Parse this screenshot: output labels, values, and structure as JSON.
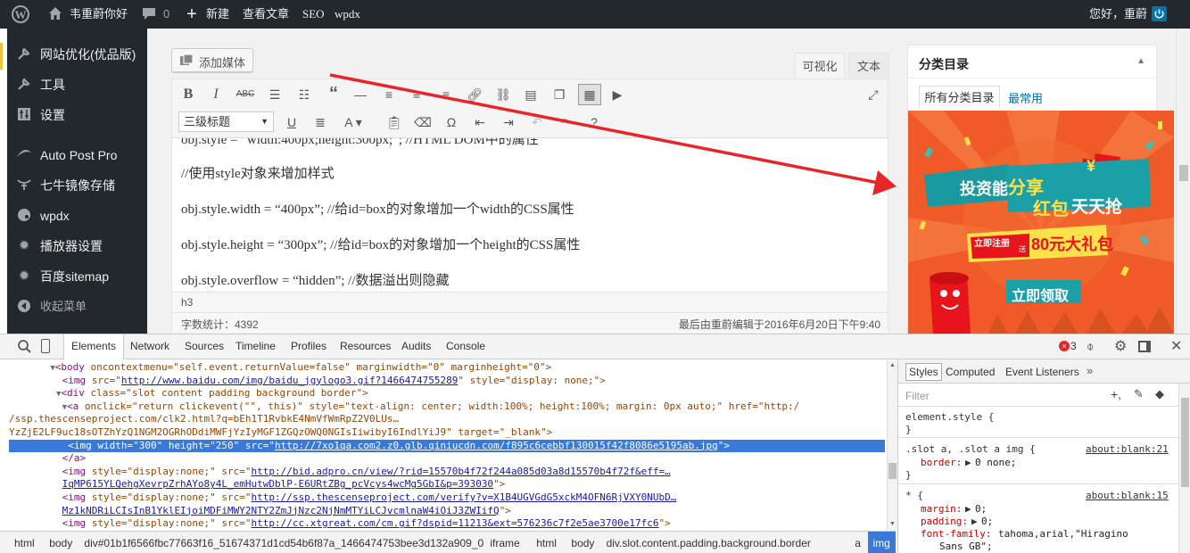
{
  "adminbar": {
    "site_name": "韦重蔚你好",
    "comments_count": "0",
    "new_label": "新建",
    "view_post": "查看文章",
    "seo": "SEO",
    "wpdx": "wpdx",
    "greeting": "您好，重蔚"
  },
  "sidebar": {
    "items": [
      {
        "label": "网站优化(优品版)",
        "icon": "wrench-icon"
      },
      {
        "label": "工具",
        "icon": "wrench-icon"
      },
      {
        "label": "设置",
        "icon": "settings-icon"
      },
      {
        "label": "Auto Post Pro",
        "icon": "app-icon"
      },
      {
        "label": "七牛镜像存储",
        "icon": "bucket-icon"
      },
      {
        "label": "wpdx",
        "icon": "palette-icon"
      },
      {
        "label": "播放器设置",
        "icon": "gear-icon"
      },
      {
        "label": "百度sitemap",
        "icon": "gear-icon"
      },
      {
        "label": "收起菜单",
        "icon": "collapse-icon"
      }
    ]
  },
  "editor": {
    "add_media": "添加媒体",
    "tab_visual": "可视化",
    "tab_text": "文本",
    "format_select": "三级标题",
    "lines": [
      "obj.style = “width:400px;height:300px;”; //HTML DOM中的属性",
      "//使用style对象来增加样式",
      "obj.style.width = “400px”;  //给id=box的对象增加一个width的CSS属性",
      "obj.style.height = “300px”; //给id=box的对象增加一个height的CSS属性",
      "obj.style.overflow = “hidden”;  //数据溢出则隐藏"
    ],
    "path": "h3",
    "word_count": "字数统计：4392",
    "last_edited": "最后由重蔚编辑于2016年6月20日下午9:40"
  },
  "category_box": {
    "title": "分类目录",
    "tab_all": "所有分类目录",
    "tab_common": "最常用"
  },
  "ad": {
    "line1a": "投资能",
    "line1b": "分享",
    "line2a": "红包",
    "line2b": "天天抢",
    "badge_small": "立即注册",
    "badge_tiny": "送",
    "badge_big": "80元大礼包",
    "button": "立即领取",
    "yen": "¥",
    "colors": {
      "bg": "#f05a28",
      "teal": "#1a9aa0",
      "yellow": "#ffe14a",
      "red": "#e8141b"
    }
  },
  "devtools": {
    "tabs": [
      "Elements",
      "Network",
      "Sources",
      "Timeline",
      "Profiles",
      "Resources",
      "Audits",
      "Console"
    ],
    "active_tab": "Elements",
    "error_count": "3",
    "lines": [
      {
        "indent": 7,
        "arrow": "▼",
        "tag": "<body",
        "attrs": " oncontextmenu=\"self.event.returnValue=false\" marginwidth=\"0\" marginheight=\"0\">",
        "tail": ""
      },
      {
        "indent": 9,
        "arrow": "",
        "tag": "<img",
        "attrs": " src=\"",
        "link": "http://www.baidu.com/img/baidu_jgylogo3.gif?1466474755289",
        "tail": "\" style=\"display: none;\">"
      },
      {
        "indent": 8,
        "arrow": "▼",
        "tag": "<div",
        "attrs": " class=\"slot content padding background border\">",
        "tail": ""
      },
      {
        "indent": 9,
        "arrow": "▼",
        "tag": "<a",
        "attrs": " onclick=\"return clickevent(\"\", this)\" style=\"text-align: center; width:100%; height:100%; margin: 0px auto;\" href=\"http:/",
        "tail": ""
      },
      {
        "indent": 0,
        "arrow": "",
        "tag": "",
        "attrs": "/ssp.thescenseproject.com/clk2.html?q=bEh1T1RvbkE4NmVfWmRpZ2V0LUs…",
        "tail": ""
      },
      {
        "indent": 0,
        "arrow": "",
        "tag": "",
        "attrs": "YzZjE2LF9uc18sOTZhYzQ1NGM2OGRhODdiMWFjYzIyMGF1ZGQzOWQ0NGIsIiwibyI6IndlYiJ9\" target=\"_blank\">",
        "tail": ""
      },
      {
        "indent": 10,
        "arrow": "",
        "tag": "<img",
        "attrs": " width=\"300\" height=\"250\" src=\"",
        "link": "http://7xo1qa.com2.z0.glb.qiniucdn.com/f895c6cebbf130015f42f8086e5195ab.jpg",
        "tail": "\">",
        "selected": true
      },
      {
        "indent": 9,
        "arrow": "",
        "tag": "</a>",
        "attrs": "",
        "tail": ""
      },
      {
        "indent": 9,
        "arrow": "",
        "tag": "<img",
        "attrs": " style=\"display:none;\" src=\"",
        "link": "http://bid.adpro.cn/view/?rid=15570b4f72f244a085d03a8d15570b4f72f&eff=…",
        "tail": ""
      },
      {
        "indent": 9,
        "arrow": "",
        "tag": "",
        "attrs": "",
        "link": "IqMP615YLQehgXevrpZrhAYo8y4L_emHutwDblP-E6URtZBg_pcVcys4wcMg5GbI&p=393030",
        "tail": "\">"
      },
      {
        "indent": 9,
        "arrow": "",
        "tag": "<img",
        "attrs": " style=\"display:none;\" src=\"",
        "link": "http://ssp.thescenseproject.com/verify?v=X1B4UGVGdG5xckM4OFN6RjVXY0NUbD…",
        "tail": ""
      },
      {
        "indent": 9,
        "arrow": "",
        "tag": "",
        "attrs": "",
        "link": "Mz1kNDRiLCIsInB1YklEIjoiMDFiMWY2NTY2ZmJjNzc2NjNmMTYiLCJvcmlnaW4iOiJ3ZWIifQ",
        "tail": "\">"
      },
      {
        "indent": 9,
        "arrow": "",
        "tag": "<img",
        "attrs": " style=\"display:none;\" src=\"",
        "link": "http://cc.xtgreat.com/cm.gif?dspid=11213&ext=576236c7f2e5ae3700e17fc6",
        "tail": "\">"
      }
    ],
    "breadcrumb": [
      "html",
      "body",
      "div#01b1f6566fbc77663f16_51674371d1cd54b6f87a_1466474753bee3d132a909_0",
      "iframe",
      "html",
      "body",
      "div.slot.content.padding.background.border",
      "a",
      "img"
    ],
    "styles": {
      "tabs": [
        "Styles",
        "Computed",
        "Event Listeners"
      ],
      "filter": "Filter",
      "element_style": "element.style {",
      "rule1_selector": ".slot a, .slot a img {",
      "rule1_source": "about:blank:21",
      "rule1_prop": "border:",
      "rule1_val": "0 none;",
      "rule2_selector": "* {",
      "rule2_source": "about:blank:15",
      "rule2_props": [
        {
          "name": "margin:",
          "value": "0;"
        },
        {
          "name": "padding:",
          "value": "0;"
        },
        {
          "name": "font-family:",
          "value": "tahoma,arial,\"Hiragino"
        }
      ],
      "rule2_cont": "Sans GB\";",
      "close_brace": "}"
    }
  },
  "annotation": {
    "color": "#e8262a"
  }
}
